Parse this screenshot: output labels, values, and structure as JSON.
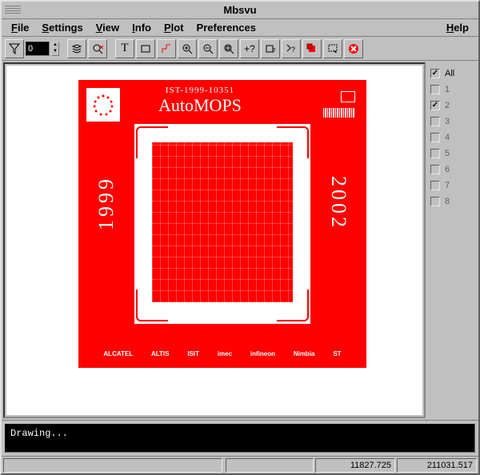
{
  "window": {
    "title": "Mbsvu"
  },
  "menu": {
    "file": "File",
    "settings": "Settings",
    "view": "View",
    "info": "Info",
    "plot": "Plot",
    "preferences": "Preferences",
    "help": "Help"
  },
  "toolbar": {
    "level_input": "0",
    "icons": {
      "funnel": "funnel-icon",
      "layers": "layers-icon",
      "zoom_reset": "zoom-reset-icon",
      "text_tool": "text-icon",
      "rect_tool": "rect-icon",
      "ruler_tool": "ruler-icon",
      "zoom_in": "zoom-in-icon",
      "zoom_out": "zoom-out-icon",
      "zoom_fit": "zoom-fit-icon",
      "help_q": "help-icon",
      "rect_q": "rect-help-icon",
      "context_help": "context-help-icon",
      "stop": "stop-icon",
      "select_area": "select-area-icon",
      "abort": "abort-icon"
    }
  },
  "design": {
    "project_code": "IST-1999-10351",
    "title": "AutoMOPS",
    "year_left": "1999",
    "year_right": "2002",
    "sponsors": [
      "ALCATEL",
      "ALTIS",
      "ISIT",
      "imec",
      "infineon",
      "Nimbia",
      "ST"
    ]
  },
  "layers": {
    "all_label": "All",
    "all_checked": true,
    "items": [
      {
        "label": "1",
        "checked": false
      },
      {
        "label": "2",
        "checked": true
      },
      {
        "label": "3",
        "checked": false
      },
      {
        "label": "4",
        "checked": false
      },
      {
        "label": "5",
        "checked": false
      },
      {
        "label": "6",
        "checked": false
      },
      {
        "label": "7",
        "checked": false
      },
      {
        "label": "8",
        "checked": false
      }
    ]
  },
  "console": {
    "message": "Drawing..."
  },
  "status": {
    "coord_x": "11827.725",
    "coord_y": "211031.517"
  }
}
